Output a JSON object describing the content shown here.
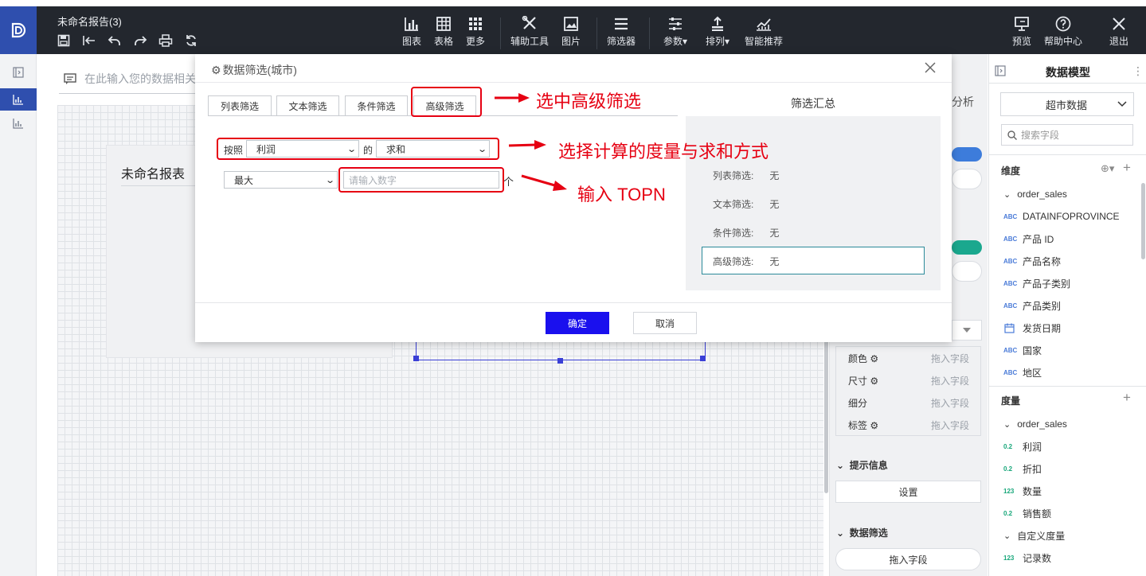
{
  "toolbar": {
    "report_title": "未命名报告(3)",
    "buttons": [
      {
        "label": "图表",
        "icon": "bar-chart-icon"
      },
      {
        "label": "表格",
        "icon": "table-icon"
      },
      {
        "label": "更多",
        "icon": "grid-dots-icon"
      },
      {
        "label": "辅助工具",
        "icon": "tools-icon"
      },
      {
        "label": "图片",
        "icon": "image-icon"
      },
      {
        "label": "筛选器",
        "icon": "filter-list-icon"
      },
      {
        "label": "参数",
        "icon": "sliders-icon"
      },
      {
        "label": "排列",
        "icon": "arrange-icon"
      },
      {
        "label": "智能推荐",
        "icon": "smart-chart-icon"
      }
    ],
    "right_buttons": [
      {
        "label": "预览",
        "icon": "preview-icon"
      },
      {
        "label": "帮助中心",
        "icon": "help-icon"
      },
      {
        "label": "退出",
        "icon": "close-icon"
      }
    ]
  },
  "command_bar": {
    "placeholder": "在此输入您的数据相关"
  },
  "report_card": {
    "title": "未命名报表"
  },
  "mid_panel": {
    "tab_fragment": "分析",
    "marks": [
      {
        "label": "颜色",
        "hint": "拖入字段"
      },
      {
        "label": "尺寸",
        "hint": "拖入字段"
      },
      {
        "label": "细分",
        "hint": "拖入字段"
      },
      {
        "label": "标签",
        "hint": "拖入字段"
      }
    ],
    "tooltip_section": "提示信息",
    "tooltip_button": "设置",
    "data_filter_section": "数据筛选",
    "data_filter_button": "拖入字段"
  },
  "data_model": {
    "title": "数据模型",
    "dataset": "超市数据",
    "search_placeholder": "搜索字段",
    "dimensions_title": "维度",
    "dimension_group": "order_sales",
    "dimensions": [
      {
        "type": "ABC",
        "name": "DATAINFOPROVINCE"
      },
      {
        "type": "ABC",
        "name": "产品 ID"
      },
      {
        "type": "ABC",
        "name": "产品名称"
      },
      {
        "type": "ABC",
        "name": "产品子类别"
      },
      {
        "type": "ABC",
        "name": "产品类别"
      },
      {
        "type": "date",
        "name": "发货日期"
      },
      {
        "type": "ABC",
        "name": "国家"
      },
      {
        "type": "ABC",
        "name": "地区"
      }
    ],
    "measures_title": "度量",
    "measure_group": "order_sales",
    "measures": [
      {
        "type": "0.2",
        "name": "利润"
      },
      {
        "type": "0.2",
        "name": "折扣"
      },
      {
        "type": "123",
        "name": "数量"
      },
      {
        "type": "0.2",
        "name": "销售额"
      }
    ],
    "custom_group": "自定义度量",
    "custom_measures": [
      {
        "type": "123",
        "name": "记录数"
      }
    ]
  },
  "dialog": {
    "title": "数据筛选(城市)",
    "tabs": [
      "列表筛选",
      "文本筛选",
      "条件筛选",
      "高级筛选"
    ],
    "active_tab": "高级筛选",
    "by_label": "按照",
    "measure_value": "利润",
    "of_label": "的",
    "aggregation_value": "求和",
    "order_value": "最大",
    "number_placeholder": "请输入数字",
    "unit_label": "个",
    "summary_title": "筛选汇总",
    "summary_rows": [
      {
        "label": "列表筛选:",
        "value": "无"
      },
      {
        "label": "文本筛选:",
        "value": "无"
      },
      {
        "label": "条件筛选:",
        "value": "无"
      },
      {
        "label": "高级筛选:",
        "value": "无"
      }
    ],
    "ok_label": "确定",
    "cancel_label": "取消"
  },
  "annotations": {
    "step1": "选中高级筛选",
    "step2": "选择计算的度量与求和方式",
    "step3": "输入 TOPN",
    "color": "#e60012"
  },
  "colors": {
    "topbar": "#23272e",
    "brand": "#2f4fae",
    "ok_button": "#1a10ee",
    "annotation_red": "#e60012"
  }
}
